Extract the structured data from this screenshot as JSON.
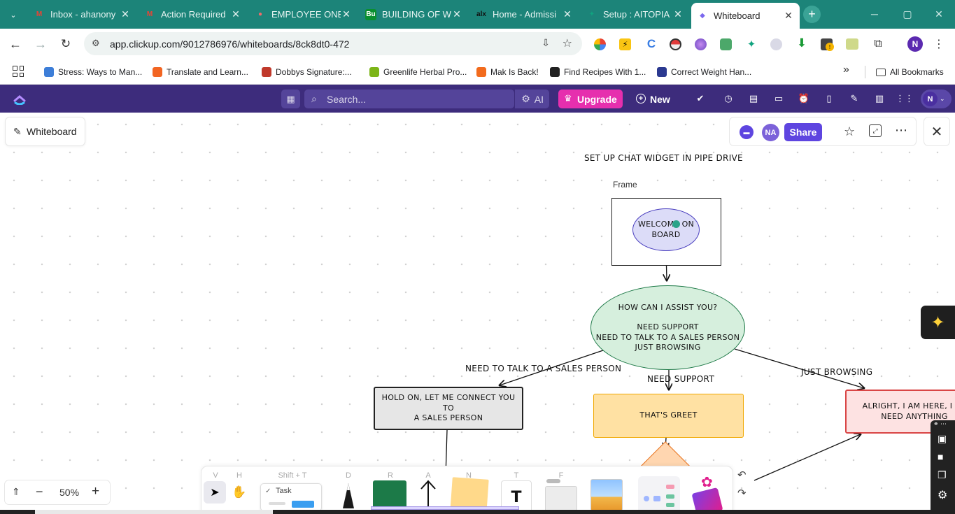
{
  "browser": {
    "tabs": [
      {
        "title": "Inbox - ahanony",
        "icon": "gmail-icon",
        "color": "#ea4335",
        "glyph": "M"
      },
      {
        "title": "Action Required",
        "icon": "gmail-icon",
        "color": "#ea4335",
        "glyph": "M"
      },
      {
        "title": "EMPLOYEE ONBO",
        "icon": "asana-icon",
        "color": "#f06a6a",
        "glyph": "●"
      },
      {
        "title": "BUILDING OF W",
        "icon": "bu-icon",
        "color": "#0a8f2f",
        "glyph": "Bu"
      },
      {
        "title": "Home - Admissi",
        "icon": "alx-icon",
        "color": "#111111",
        "glyph": "alx"
      },
      {
        "title": "Setup : AITOPIA",
        "icon": "aitopia-icon",
        "color": "#10a37f",
        "glyph": "✦"
      },
      {
        "title": "Whiteboard",
        "icon": "clickup-icon",
        "color": "#7b68ee",
        "glyph": "◆"
      }
    ],
    "url": "app.clickup.com/9012786976/whiteboards/8ck8dt0-472",
    "profile_initial": "N",
    "bookmarks": [
      {
        "label": "Stress: Ways to Man...",
        "color": "#3d7ed8"
      },
      {
        "label": "Translate and Learn...",
        "color": "#f26522"
      },
      {
        "label": "Dobbys Signature:...",
        "color": "#c0392b"
      },
      {
        "label": "Greenlife Herbal Pro...",
        "color": "#7cb518"
      },
      {
        "label": "Mak Is Back!",
        "color": "#f26b1d"
      },
      {
        "label": "Find Recipes With 1...",
        "color": "#222222"
      },
      {
        "label": "Correct Weight Han...",
        "color": "#2b3990"
      }
    ],
    "bookmarks_overflow": "»",
    "all_bookmarks": "All Bookmarks"
  },
  "clickup": {
    "search_placeholder": "Search...",
    "ai_label": "AI",
    "upgrade_label": "Upgrade",
    "new_label": "New",
    "avatar_initial": "N"
  },
  "whiteboard": {
    "title": "Whiteboard",
    "share_label": "Share",
    "user_initials": "NA",
    "zoom": "50%"
  },
  "diagram": {
    "title": "SET UP CHAT WIDGET IN PIPE DRIVE",
    "frame_label": "Frame",
    "welcome": [
      "WELCOME ON",
      "BOARD"
    ],
    "assist": [
      "HOW CAN I ASSIST YOU?",
      "",
      "NEED SUPPORT",
      "NEED TO TALK TO A SALES PERSON",
      "JUST BROWSING"
    ],
    "edge_sales": "NEED TO TALK TO A SALES PERSON",
    "edge_support": "NEED SUPPORT",
    "edge_browsing": "JUST BROWSING",
    "hold_on": [
      "HOLD ON, LET ME CONNECT YOU TO",
      "A SALES PERSON"
    ],
    "thats_greet": "THAT'S GREET",
    "alright": [
      "ALRIGHT, I AM HERE, I",
      "NEED ANYTHING"
    ]
  },
  "toolbar": {
    "keys": [
      "V",
      "H",
      "Shift + T",
      "D",
      "R",
      "A",
      "N",
      "T",
      "F"
    ],
    "task_label": "Task"
  }
}
